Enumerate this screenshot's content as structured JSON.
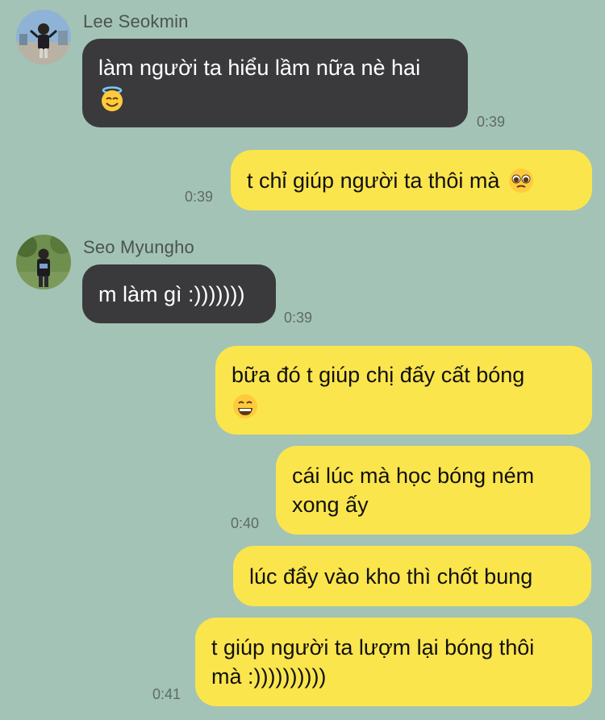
{
  "colors": {
    "background": "#a3c3b6",
    "incoming_bubble": "#3a3a3c",
    "outgoing_bubble": "#fbe54d",
    "timestamp": "#5f6b66"
  },
  "messages": [
    {
      "id": "m1",
      "direction": "incoming",
      "sender": "Lee Seokmin",
      "avatar": "avatar-photo",
      "text": "làm người ta hiểu lầm nữa nè hai",
      "emoji": "smiling-face-with-halo-icon",
      "time": "0:39"
    },
    {
      "id": "m2",
      "direction": "outgoing",
      "text": "t chỉ giúp người ta thôi mà",
      "emoji": "pleading-face-icon",
      "time": "0:39"
    },
    {
      "id": "m3",
      "direction": "incoming",
      "sender": "Seo Myungho",
      "avatar": "avatar-photo",
      "text": "m làm gì :)))))))",
      "time": "0:39"
    },
    {
      "id": "m4",
      "direction": "outgoing",
      "text": "bữa đó t giúp chị đấy cất bóng",
      "emoji": "grinning-face-icon",
      "time": ""
    },
    {
      "id": "m5",
      "direction": "outgoing",
      "lines": [
        "cái lúc mà học bóng ném",
        "xong ấy"
      ],
      "time": "0:40"
    },
    {
      "id": "m6",
      "direction": "outgoing",
      "text": "lúc đẩy vào kho thì chốt bung",
      "time": ""
    },
    {
      "id": "m7",
      "direction": "outgoing",
      "lines": [
        "t giúp người ta lượm lại bóng thôi",
        "mà :))))))))))"
      ],
      "time": "0:41"
    }
  ]
}
